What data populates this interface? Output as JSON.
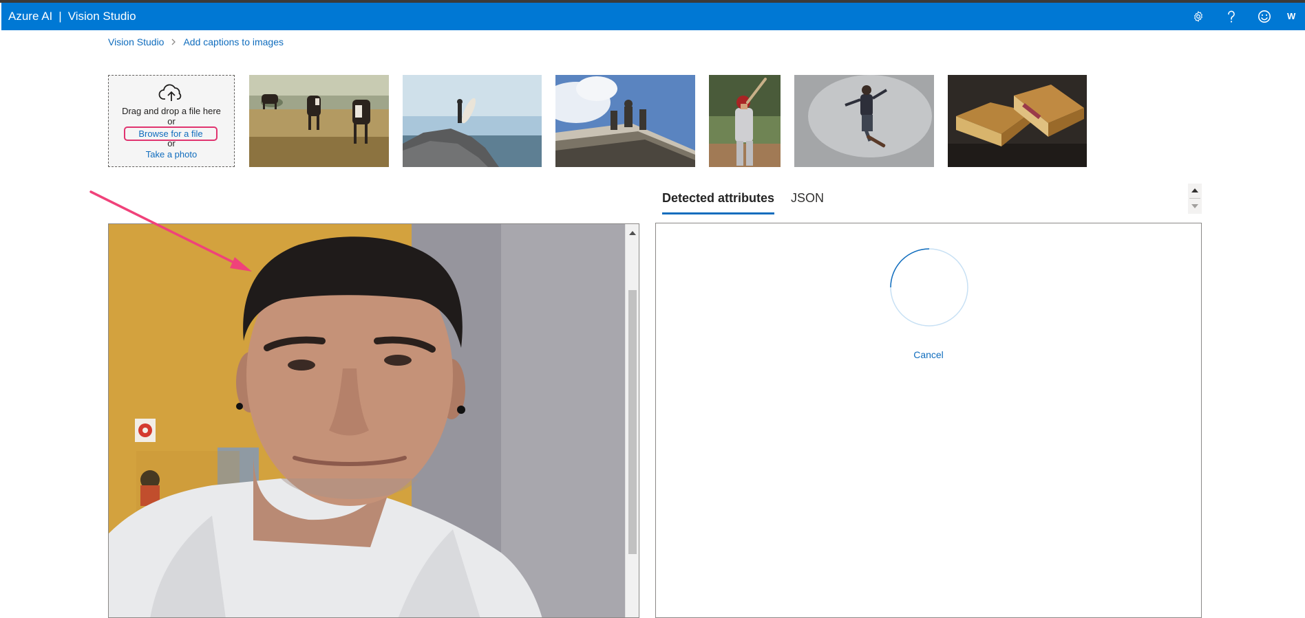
{
  "app": {
    "product": "Azure AI",
    "separator": "|",
    "name": "Vision Studio",
    "account_initial": "W"
  },
  "header_icons": [
    "settings-gear-icon",
    "help-question-icon",
    "feedback-smiley-icon"
  ],
  "breadcrumb": {
    "items": [
      "Vision Studio",
      "Add captions to images"
    ],
    "separator_icon": "chevron-right-icon"
  },
  "upload": {
    "instruction": "Drag and drop a file here",
    "or_1": "or",
    "browse_label": "Browse for a file",
    "or_2": "or",
    "photo_label": "Take a photo",
    "icon": "cloud-upload-icon",
    "highlight_color": "#e0336f"
  },
  "sample_images": [
    {
      "name": "cows grazing in a field"
    },
    {
      "name": "surfer on a rock by the sea"
    },
    {
      "name": "statues on a building roof"
    },
    {
      "name": "baseball batter"
    },
    {
      "name": "skateboarder in the air"
    },
    {
      "name": "grilled sandwich"
    }
  ],
  "preview": {
    "subject": "selfie of a man in a white t-shirt"
  },
  "results": {
    "tabs": [
      "Detected attributes",
      "JSON"
    ],
    "active_tab": "Detected attributes",
    "loading": true,
    "cancel_label": "Cancel"
  },
  "colors": {
    "header_bg": "#0078d4",
    "link": "#0f6cbd",
    "annotation_arrow": "#f0427a"
  }
}
